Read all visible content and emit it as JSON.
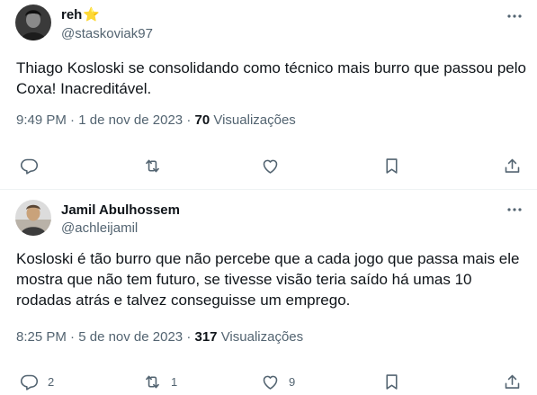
{
  "tweets": [
    {
      "display_name": "reh",
      "badge": "⭐",
      "handle": "@staskoviak97",
      "text": "Thiago Kosloski se consolidando como técnico mais burro que passou pelo Coxa! Inacreditável.",
      "time": "9:49 PM",
      "sep1": "·",
      "date": "1 de nov de 2023",
      "sep2": "·",
      "views_count": "70",
      "views_label": "Visualizações",
      "replies": "",
      "retweets": "",
      "likes": ""
    },
    {
      "display_name": "Jamil Abulhossem",
      "handle": "@achleijamil",
      "text": "Kosloski é tão burro que não percebe que a cada jogo que passa mais ele mostra que não tem futuro, se tivesse visão teria saído há umas 10 rodadas atrás e talvez conseguisse um emprego.",
      "time": "8:25 PM",
      "sep1": "·",
      "date": "5 de nov de 2023",
      "sep2": "·",
      "views_count": "317",
      "views_label": "Visualizações",
      "replies": "2",
      "retweets": "1",
      "likes": "9"
    }
  ],
  "icons": [
    "more-icon",
    "reply-icon",
    "retweet-icon",
    "like-icon",
    "bookmark-icon",
    "share-icon"
  ],
  "colors": {
    "text": "#0f1419",
    "secondary": "#536471",
    "divider": "#eff3f4",
    "badge": "#f5b400"
  }
}
